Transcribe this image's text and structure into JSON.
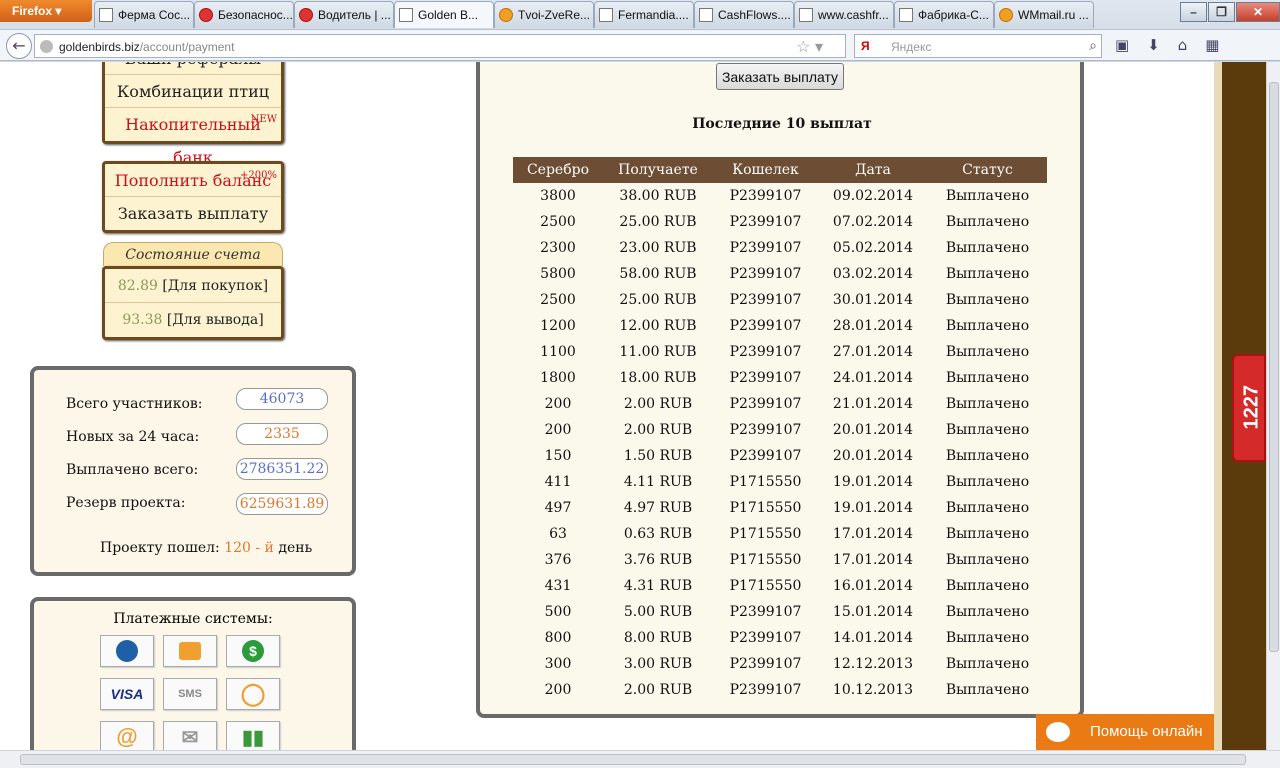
{
  "browser": {
    "app_button": "Firefox",
    "tabs": [
      {
        "label": "Ферма Сос...",
        "icon": "page-icon"
      },
      {
        "label": "Безопаснос...",
        "icon": "red-p-icon"
      },
      {
        "label": "Водитель | ...",
        "icon": "red-p-icon"
      },
      {
        "label": "Golden B...",
        "icon": "page-icon",
        "active": true
      },
      {
        "label": "Tvoi-ZveRe...",
        "icon": "orange-icon"
      },
      {
        "label": "Fermandia....",
        "icon": "page-icon"
      },
      {
        "label": "CashFlows....",
        "icon": "page-icon"
      },
      {
        "label": "www.cashfr...",
        "icon": "page-icon"
      },
      {
        "label": "Фабрика-С...",
        "icon": "page-icon"
      },
      {
        "label": "WMmail.ru ...",
        "icon": "orange-icon"
      }
    ],
    "url_host": "goldenbirds.biz",
    "url_path": "/account/payment",
    "search_placeholder": "Яндекс",
    "search_engine_badge": "Я"
  },
  "sidebar": {
    "menu_top": [
      {
        "label": "Ваши рефералы"
      },
      {
        "label": "Комбинации птиц"
      },
      {
        "label": "Накопительный банк",
        "badge": "NEW",
        "accent": true
      }
    ],
    "menu_money": [
      {
        "label": "Пополнить баланс",
        "badge": "+200%",
        "accent": true
      },
      {
        "label": "Заказать выплату"
      }
    ],
    "account_state": {
      "title": "Состояние счета",
      "purchase_value": "82.89",
      "purchase_label": "[Для покупок]",
      "withdraw_value": "93.38",
      "withdraw_label": "[Для вывода]"
    },
    "stats": {
      "total_participants_label": "Всего участников:",
      "total_participants": "46073",
      "new_24h_label": "Новых за 24 часа:",
      "new_24h": "2335",
      "paid_total_label": "Выплачено всего:",
      "paid_total": "2786351.22",
      "reserve_label": "Резерв проекта:",
      "reserve": "6259631.89",
      "running_prefix": "Проекту пошел:",
      "running_value": "120 - й",
      "running_suffix": "день"
    },
    "payment_systems": {
      "title": "Платежные системы:",
      "icons": [
        "webmoney-icon",
        "yandex-money-icon",
        "dollar-icon",
        "visa-icon",
        "sms-icon",
        "qiwi-icon",
        "mail-at-icon",
        "envelope-icon",
        "bars-icon"
      ],
      "visa_text": "VISA",
      "sms_text": "SMS"
    }
  },
  "main": {
    "order_button": "Заказать выплату",
    "table_title": "Последние 10 выплат",
    "columns": [
      "Серебро",
      "Получаете",
      "Кошелек",
      "Дата",
      "Статус"
    ],
    "rows": [
      [
        "3800",
        "38.00 RUB",
        "P2399107",
        "09.02.2014",
        "Выплачено"
      ],
      [
        "2500",
        "25.00 RUB",
        "P2399107",
        "07.02.2014",
        "Выплачено"
      ],
      [
        "2300",
        "23.00 RUB",
        "P2399107",
        "05.02.2014",
        "Выплачено"
      ],
      [
        "5800",
        "58.00 RUB",
        "P2399107",
        "03.02.2014",
        "Выплачено"
      ],
      [
        "2500",
        "25.00 RUB",
        "P2399107",
        "30.01.2014",
        "Выплачено"
      ],
      [
        "1200",
        "12.00 RUB",
        "P2399107",
        "28.01.2014",
        "Выплачено"
      ],
      [
        "1100",
        "11.00 RUB",
        "P2399107",
        "27.01.2014",
        "Выплачено"
      ],
      [
        "1800",
        "18.00 RUB",
        "P2399107",
        "24.01.2014",
        "Выплачено"
      ],
      [
        "200",
        "2.00 RUB",
        "P2399107",
        "21.01.2014",
        "Выплачено"
      ],
      [
        "200",
        "2.00 RUB",
        "P2399107",
        "20.01.2014",
        "Выплачено"
      ],
      [
        "150",
        "1.50 RUB",
        "P2399107",
        "20.01.2014",
        "Выплачено"
      ],
      [
        "411",
        "4.11 RUB",
        "P1715550",
        "19.01.2014",
        "Выплачено"
      ],
      [
        "497",
        "4.97 RUB",
        "P1715550",
        "19.01.2014",
        "Выплачено"
      ],
      [
        "63",
        "0.63 RUB",
        "P1715550",
        "17.01.2014",
        "Выплачено"
      ],
      [
        "376",
        "3.76 RUB",
        "P1715550",
        "17.01.2014",
        "Выплачено"
      ],
      [
        "431",
        "4.31 RUB",
        "P1715550",
        "16.01.2014",
        "Выплачено"
      ],
      [
        "500",
        "5.00 RUB",
        "P2399107",
        "15.01.2014",
        "Выплачено"
      ],
      [
        "800",
        "8.00 RUB",
        "P2399107",
        "14.01.2014",
        "Выплачено"
      ],
      [
        "300",
        "3.00 RUB",
        "P2399107",
        "12.12.2013",
        "Выплачено"
      ],
      [
        "200",
        "2.00 RUB",
        "P2399107",
        "10.12.2013",
        "Выплачено"
      ]
    ]
  },
  "widgets": {
    "red_counter": "1227",
    "help_online": "Помощь онлайн"
  },
  "colors": {
    "accent_red": "#c8101c",
    "table_header": "#6d4d33",
    "help_orange": "#e97a14",
    "stat_blue": "#5c6fc8",
    "stat_orange": "#e0782a"
  }
}
